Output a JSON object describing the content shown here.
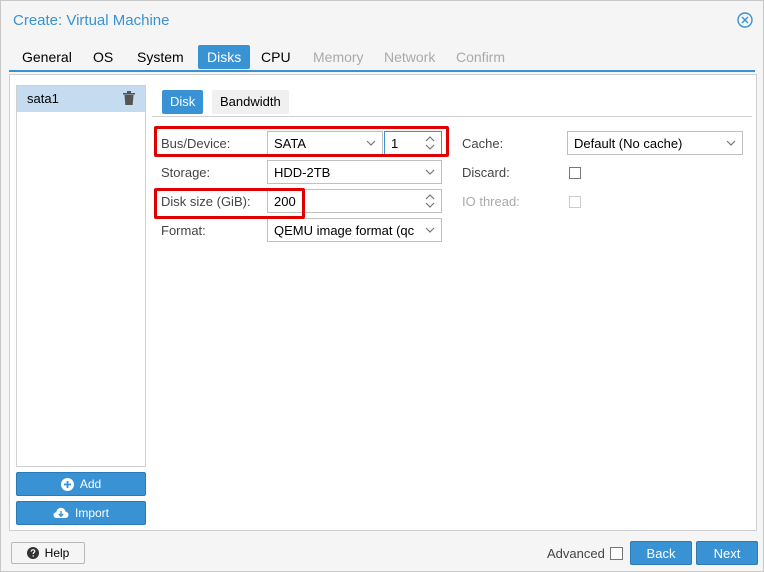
{
  "window": {
    "title": "Create: Virtual Machine"
  },
  "tabs": [
    {
      "label": "General",
      "state": "normal"
    },
    {
      "label": "OS",
      "state": "normal"
    },
    {
      "label": "System",
      "state": "normal"
    },
    {
      "label": "Disks",
      "state": "active"
    },
    {
      "label": "CPU",
      "state": "normal"
    },
    {
      "label": "Memory",
      "state": "disabled"
    },
    {
      "label": "Network",
      "state": "disabled"
    },
    {
      "label": "Confirm",
      "state": "disabled"
    }
  ],
  "disk_list": {
    "items": [
      {
        "label": "sata1"
      }
    ]
  },
  "side_buttons": {
    "add_label": "Add",
    "import_label": "Import"
  },
  "subtabs": {
    "disk": "Disk",
    "bandwidth": "Bandwidth"
  },
  "form": {
    "bus_device": {
      "label": "Bus/Device:",
      "bus": "SATA",
      "device": "1"
    },
    "storage": {
      "label": "Storage:",
      "value": "HDD-2TB"
    },
    "disk_size": {
      "label": "Disk size (GiB):",
      "value": "200"
    },
    "format": {
      "label": "Format:",
      "value": "QEMU image format (qc"
    },
    "cache": {
      "label": "Cache:",
      "value": "Default (No cache)"
    },
    "discard": {
      "label": "Discard:",
      "checked": false
    },
    "io_thread": {
      "label": "IO thread:",
      "checked": false,
      "disabled": true
    }
  },
  "footer": {
    "help_label": "Help",
    "advanced_label": "Advanced",
    "advanced_checked": false,
    "back_label": "Back",
    "next_label": "Next"
  },
  "colors": {
    "accent": "#3892d4",
    "highlight": "#e00000"
  }
}
